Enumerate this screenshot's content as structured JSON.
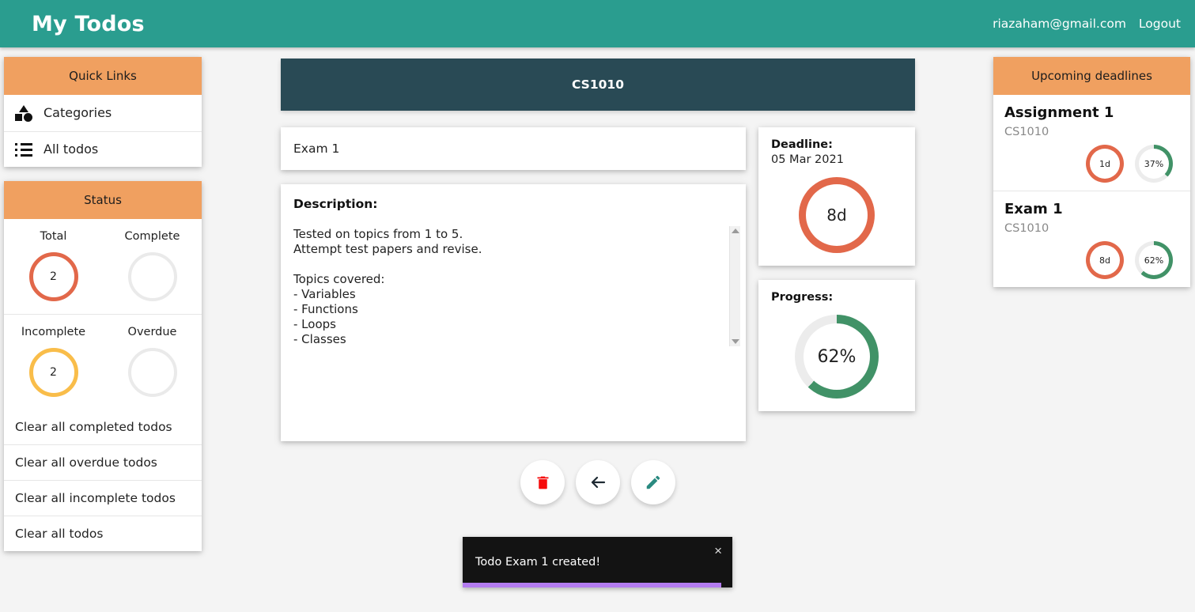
{
  "navbar": {
    "brand": "My Todos",
    "email": "riazaham@gmail.com",
    "logout": "Logout"
  },
  "sidebar": {
    "quick_links": {
      "heading": "Quick Links",
      "items": [
        {
          "label": "Categories",
          "icon": "shapes-icon"
        },
        {
          "label": "All todos",
          "icon": "list-icon"
        }
      ]
    },
    "status": {
      "heading": "Status",
      "cells": [
        {
          "label": "Total",
          "value": "2",
          "color": "#e2684a"
        },
        {
          "label": "Complete",
          "value": "",
          "color": "#eaeaea"
        },
        {
          "label": "Incomplete",
          "value": "2",
          "color": "#f9bd4a"
        },
        {
          "label": "Overdue",
          "value": "",
          "color": "#eaeaea"
        }
      ]
    },
    "clear_actions": [
      "Clear all completed todos",
      "Clear all overdue todos",
      "Clear all incomplete todos",
      "Clear all todos"
    ]
  },
  "main": {
    "category": "CS1010",
    "todo_title": "Exam 1",
    "description_label": "Description:",
    "description": "Tested on topics from 1 to 5.\nAttempt test papers and revise.\n\nTopics covered:\n- Variables\n- Functions\n- Loops\n- Classes",
    "deadline": {
      "label": "Deadline:",
      "date": "05 Mar 2021",
      "days_left": "8d",
      "color": "#e2684a"
    },
    "progress": {
      "label": "Progress:",
      "value": "62%",
      "percent": 62,
      "color": "#419267"
    },
    "actions": [
      {
        "name": "delete",
        "icon": "trash-icon",
        "color": "#f60b0b"
      },
      {
        "name": "back",
        "icon": "arrow-left-icon",
        "color": "#1e2a33"
      },
      {
        "name": "edit",
        "icon": "pencil-icon",
        "color": "#2a8a80"
      }
    ]
  },
  "upcoming": {
    "heading": "Upcoming deadlines",
    "items": [
      {
        "title": "Assignment 1",
        "category": "CS1010",
        "days_left": "1d",
        "days_color": "#e2684a",
        "progress": "37%",
        "progress_percent": 37,
        "progress_color": "#419267"
      },
      {
        "title": "Exam 1",
        "category": "CS1010",
        "days_left": "8d",
        "days_color": "#e2684a",
        "progress": "62%",
        "progress_percent": 62,
        "progress_color": "#419267"
      }
    ]
  },
  "toast": {
    "message": "Todo Exam 1 created!",
    "close": "×",
    "bar_percent": 96,
    "bar_color": "#b47cf0"
  },
  "theme": {
    "teal": "#2a9d8f",
    "orange_panel": "#f0a060",
    "navy": "#294a55",
    "page_bg": "#f4f4f4"
  }
}
